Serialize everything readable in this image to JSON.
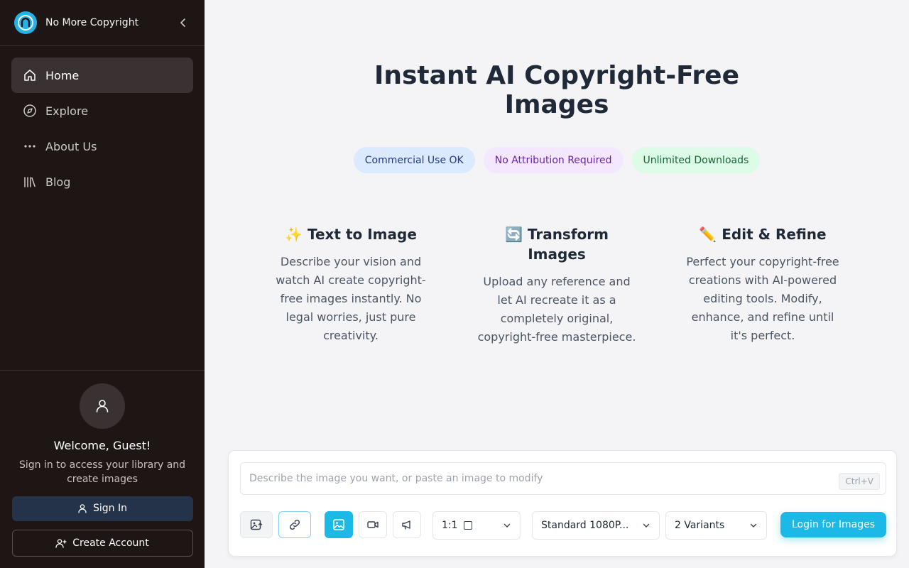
{
  "app": {
    "title": "No More Copyright"
  },
  "sidebar": {
    "items": [
      {
        "label": "Home",
        "icon": "home-icon",
        "active": true
      },
      {
        "label": "Explore",
        "icon": "compass-icon",
        "active": false
      },
      {
        "label": "About Us",
        "icon": "more-dots-icon",
        "active": false
      },
      {
        "label": "Blog",
        "icon": "library-icon",
        "active": false
      }
    ],
    "guest": {
      "welcome": "Welcome, Guest!",
      "subtitle": "Sign in to access your library and create images",
      "sign_in": "Sign In",
      "create_account": "Create Account"
    }
  },
  "hero": {
    "title_line1": "Instant AI Copyright-Free",
    "title_line2": "Images",
    "badges": [
      "Commercial Use OK",
      "No Attribution Required",
      "Unlimited Downloads"
    ]
  },
  "features": [
    {
      "emoji": "✨",
      "title": "Text to Image",
      "desc": "Describe your vision and watch AI create copyright-free images instantly. No legal worries, just pure creativity."
    },
    {
      "emoji": "🔄",
      "title": "Transform Images",
      "desc": "Upload any reference and let AI recreate it as a completely original, copyright-free masterpiece."
    },
    {
      "emoji": "✏️",
      "title": "Edit & Refine",
      "desc": "Perfect your copyright-free creations with AI-powered editing tools. Modify, enhance, and refine until it's perfect."
    }
  ],
  "composer": {
    "placeholder": "Describe the image you want, or paste an image to modify",
    "shortcut": "Ctrl+V",
    "aspect_ratio": "1:1",
    "quality": "Standard 1080P...",
    "variants": "2 Variants",
    "submit": "Login for Images"
  },
  "colors": {
    "accent": "#1cb8e6",
    "sidebar_bg": "#1e1515"
  }
}
